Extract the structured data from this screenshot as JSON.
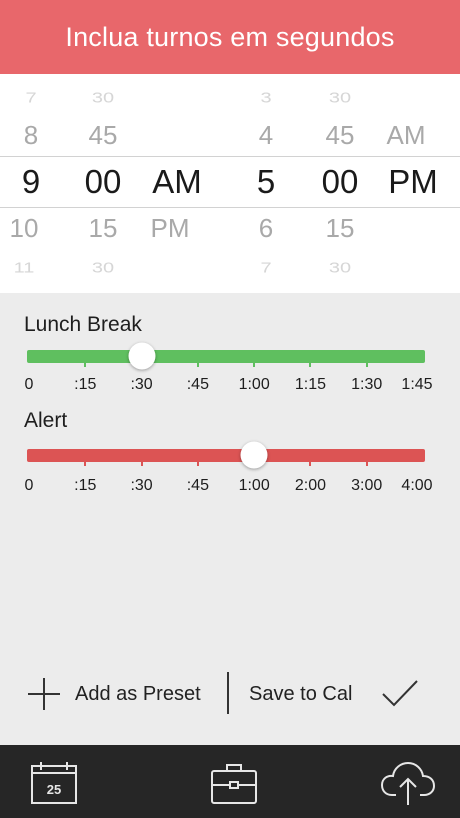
{
  "header": {
    "title": "Inclua turnos em segundos"
  },
  "picker": {
    "start": {
      "hours": [
        "7",
        "8",
        "9",
        "10",
        "11"
      ],
      "minutes": [
        "30",
        "45",
        "00",
        "15",
        "30"
      ],
      "period": [
        "",
        "",
        "AM",
        "PM",
        ""
      ]
    },
    "end": {
      "hours": [
        "3",
        "4",
        "5",
        "6",
        "7"
      ],
      "minutes": [
        "30",
        "45",
        "00",
        "15",
        "30"
      ],
      "period": [
        "",
        "AM",
        "PM",
        "",
        ""
      ]
    }
  },
  "lunch": {
    "title": "Lunch Break",
    "ticks": [
      "0",
      ":15",
      ":30",
      ":45",
      "1:00",
      "1:15",
      "1:30",
      "1:45"
    ],
    "selected_index": 2,
    "color": "#5fbf5f"
  },
  "alert": {
    "title": "Alert",
    "ticks": [
      "0",
      ":15",
      ":30",
      ":45",
      "1:00",
      "2:00",
      "3:00",
      "4:00"
    ],
    "selected_index": 4,
    "color": "#dc5454"
  },
  "actions": {
    "add_preset": "Add as Preset",
    "save_to_cal": "Save to Cal"
  },
  "tabbar": {
    "calendar_day": "25"
  },
  "colors": {
    "accent": "#e8676b",
    "tabbar": "#262626"
  }
}
